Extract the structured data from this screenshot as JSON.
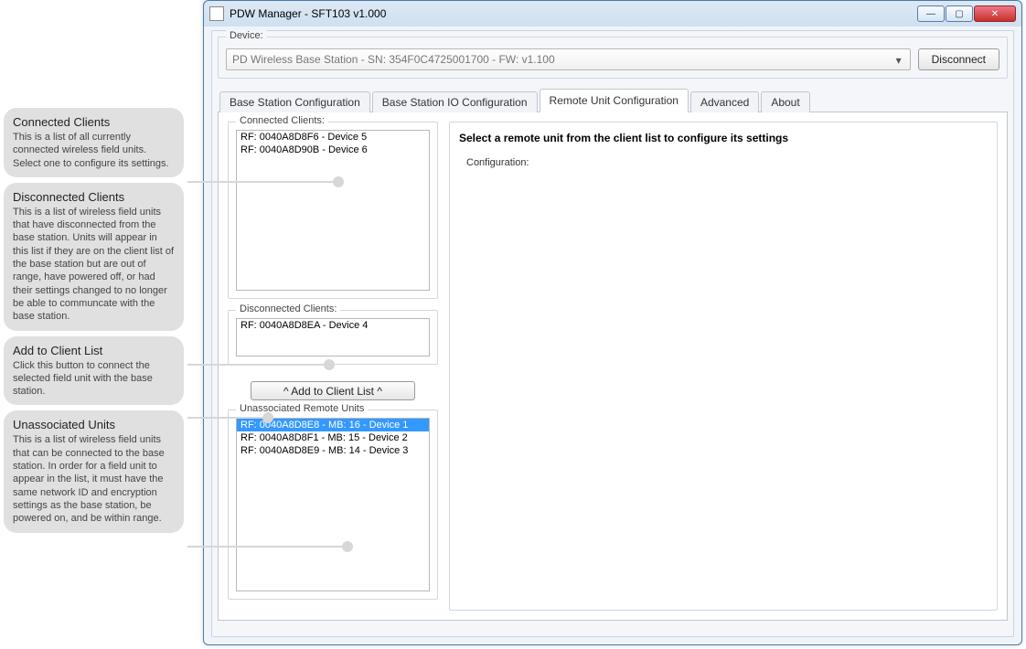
{
  "window": {
    "title": "PDW Manager - SFT103 v1.000"
  },
  "device": {
    "legend": "Device:",
    "combo_text": "PD Wireless Base Station - SN: 354F0C4725001700 - FW: v1.100",
    "disconnect_label": "Disconnect"
  },
  "tabs": {
    "base_config": "Base Station Configuration",
    "base_io": "Base Station IO Configuration",
    "remote": "Remote Unit Configuration",
    "advanced": "Advanced",
    "about": "About"
  },
  "remote_page": {
    "connected_legend": "Connected Clients:",
    "connected_items": [
      "RF: 0040A8D8F6 - Device 5",
      "RF: 0040A8D90B - Device 6"
    ],
    "disconnected_legend": "Disconnected Clients:",
    "disconnected_items": [
      "RF: 0040A8D8EA - Device 4"
    ],
    "add_button": "^  Add to Client List  ^",
    "unassoc_legend": "Unassociated Remote Units",
    "unassoc_items": [
      "RF: 0040A8D8E8 - MB: 16 - Device 1",
      "RF: 0040A8D8F1 - MB: 15 - Device 2",
      "RF: 0040A8D8E9 - MB: 14 - Device 3"
    ],
    "right_heading": "Select a remote unit from the client list to configure its settings",
    "config_label": "Configuration:"
  },
  "annotations": {
    "a1_title": "Connected Clients",
    "a1_body": "This is a list of all currently connected wireless field units. Select one to configure its settings.",
    "a2_title": "Disconnected Clients",
    "a2_body": "This is a list of wireless field units that have disconnected from the base station. Units will appear in this list if they are on the client list of the base station but are out of range, have powered off, or had their settings changed to no longer be able to communcate with the base station.",
    "a3_title": "Add to Client List",
    "a3_body": "Click this button to connect the selected field unit with the base station.",
    "a4_title": "Unassociated Units",
    "a4_body": "This is a list of wireless field units that can be connected to the base station. In order for a field unit to appear in the list, it must have the same network ID and encryption settings as the base station, be powered on, and be within range."
  }
}
